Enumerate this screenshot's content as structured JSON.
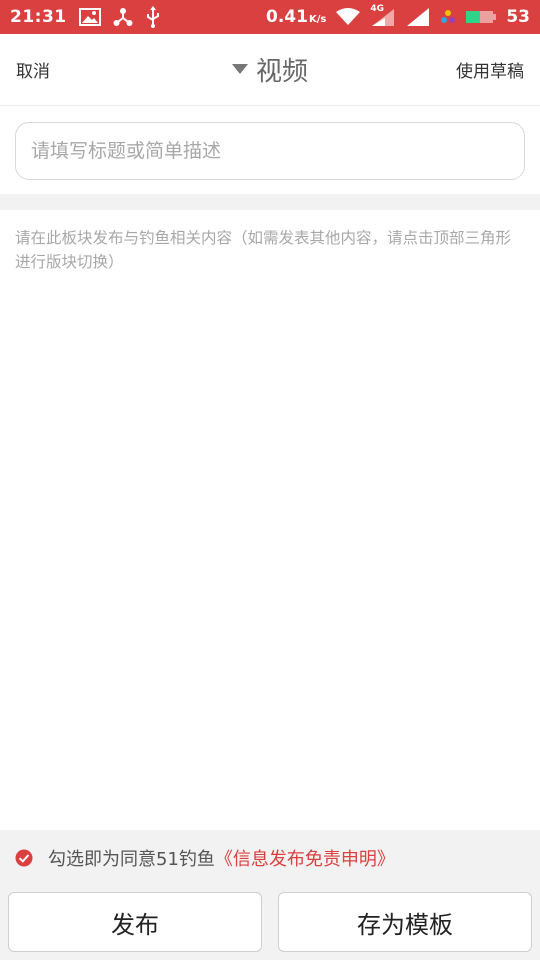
{
  "status_bar": {
    "time": "21:31",
    "net_speed": "0.41",
    "net_speed_unit": "K/s",
    "network_type": "4G",
    "battery_level": "53",
    "icons": [
      "image-icon",
      "share-icon",
      "usb-icon",
      "wifi-icon",
      "signal-icon",
      "signal-icon",
      "color-dots-icon",
      "battery-icon"
    ],
    "color_bg": "#d9403f"
  },
  "nav": {
    "cancel_label": "取消",
    "title": "视频",
    "draft_label": "使用草稿"
  },
  "form": {
    "title_placeholder": "请填写标题或简单描述",
    "title_value": "",
    "content_placeholder": "请在此板块发布与钓鱼相关内容（如需发表其他内容，请点击顶部三角形进行版块切换）",
    "content_value": ""
  },
  "agreement": {
    "checked": true,
    "text": "勾选即为同意51钓鱼",
    "link_text": "《信息发布免责申明》"
  },
  "buttons": {
    "publish_label": "发布",
    "save_template_label": "存为模板"
  },
  "colors": {
    "accent": "#d9403f",
    "divider": "#f2f2f2"
  }
}
